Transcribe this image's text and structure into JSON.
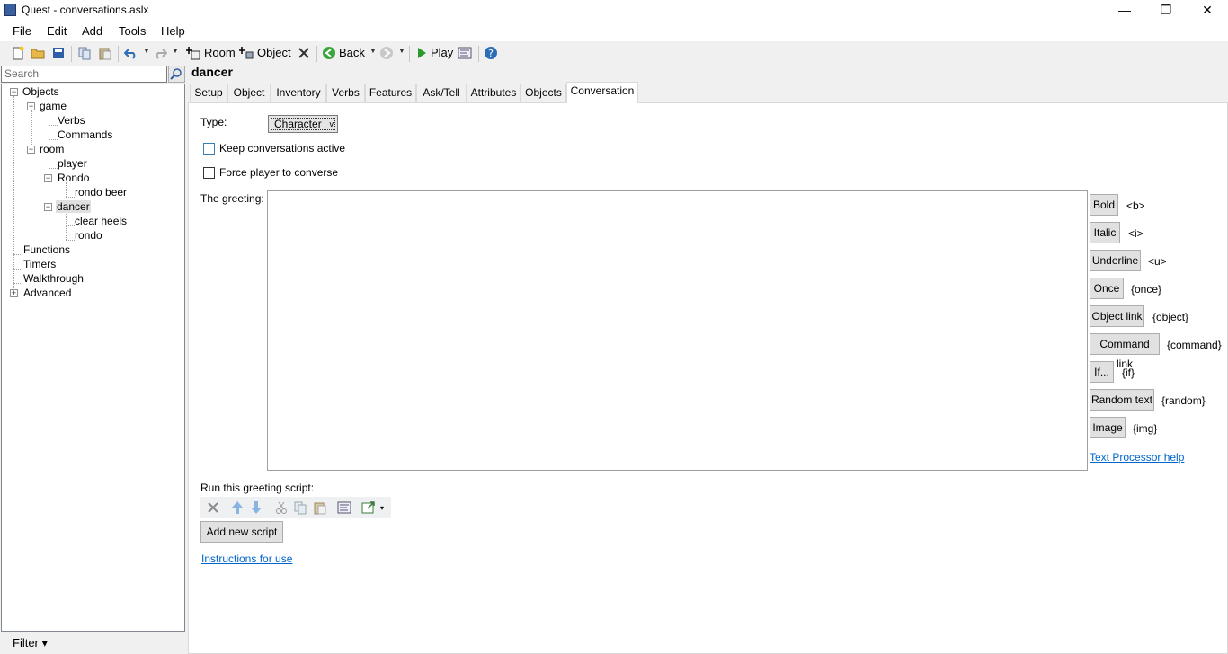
{
  "window": {
    "title": "Quest - conversations.aslx",
    "minimize": "—",
    "maximize": "❐",
    "close": "✕"
  },
  "menu": [
    "File",
    "Edit",
    "Add",
    "Tools",
    "Help"
  ],
  "toolbar": {
    "room_label": "Room",
    "object_label": "Object",
    "back_label": "Back",
    "play_label": "Play"
  },
  "search": {
    "placeholder": "Search"
  },
  "tree": {
    "objects": "Objects",
    "game": "game",
    "verbs": "Verbs",
    "commands": "Commands",
    "room": "room",
    "player": "player",
    "rondo_obj": "Rondo",
    "rondo_beer": "rondo beer",
    "dancer": "dancer",
    "clear_heels": "clear heels",
    "rondo": "rondo",
    "functions": "Functions",
    "timers": "Timers",
    "walkthrough": "Walkthrough",
    "advanced": "Advanced"
  },
  "filter_label": "Filter ▾",
  "editor": {
    "heading": "dancer",
    "tabs": [
      "Setup",
      "Object",
      "Inventory",
      "Verbs",
      "Features",
      "Ask/Tell",
      "Attributes",
      "Objects",
      "Conversation"
    ],
    "active_tab": "Conversation",
    "type_label": "Type:",
    "type_value": "Character",
    "keep_active_label": "Keep conversations active",
    "force_converse_label": "Force player to converse",
    "greeting_label": "The greeting:",
    "formatting": [
      {
        "button": "Bold",
        "tag": "<b>"
      },
      {
        "button": "Italic",
        "tag": "<i>"
      },
      {
        "button": "Underline",
        "tag": "<u>"
      },
      {
        "button": "Once",
        "tag": "{once}"
      },
      {
        "button": "Object link",
        "tag": "{object}"
      },
      {
        "button": "Command link",
        "tag": "{command}"
      },
      {
        "button": "If...",
        "tag": "{if}"
      },
      {
        "button": "Random text",
        "tag": "{random}"
      },
      {
        "button": "Image",
        "tag": "{img}"
      }
    ],
    "text_processor_help": "Text Processor help",
    "script_label": "Run this greeting script:",
    "add_script": "Add new script",
    "instructions": "Instructions for use"
  }
}
